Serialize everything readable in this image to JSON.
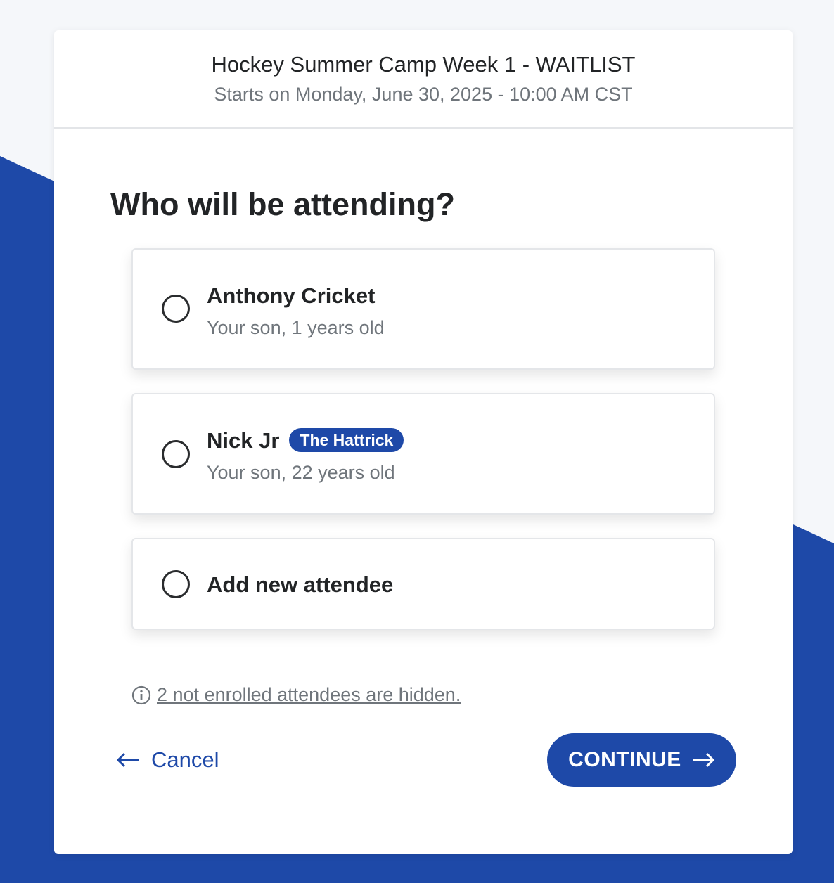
{
  "event": {
    "title": "Hockey Summer Camp Week 1 - WAITLIST",
    "subtitle": "Starts on Monday, June 30, 2025 - 10:00 AM CST"
  },
  "question": "Who will be attending?",
  "attendees": [
    {
      "name": "Anthony Cricket",
      "detail": "Your son, 1 years old",
      "selected": false
    },
    {
      "name": "Nick Jr",
      "badge": "The Hattrick",
      "detail": "Your son, 22 years old",
      "selected": false
    },
    {
      "name": "Add new attendee",
      "selected": false
    }
  ],
  "hidden_note": {
    "icon": "info-icon",
    "text": "2 not enrolled attendees are hidden."
  },
  "actions": {
    "cancel_label": "Cancel",
    "continue_label": "CONTINUE"
  },
  "colors": {
    "brand": "#1e49a8",
    "background": "#f5f7fa",
    "text": "#222426",
    "muted": "#6f757b"
  }
}
